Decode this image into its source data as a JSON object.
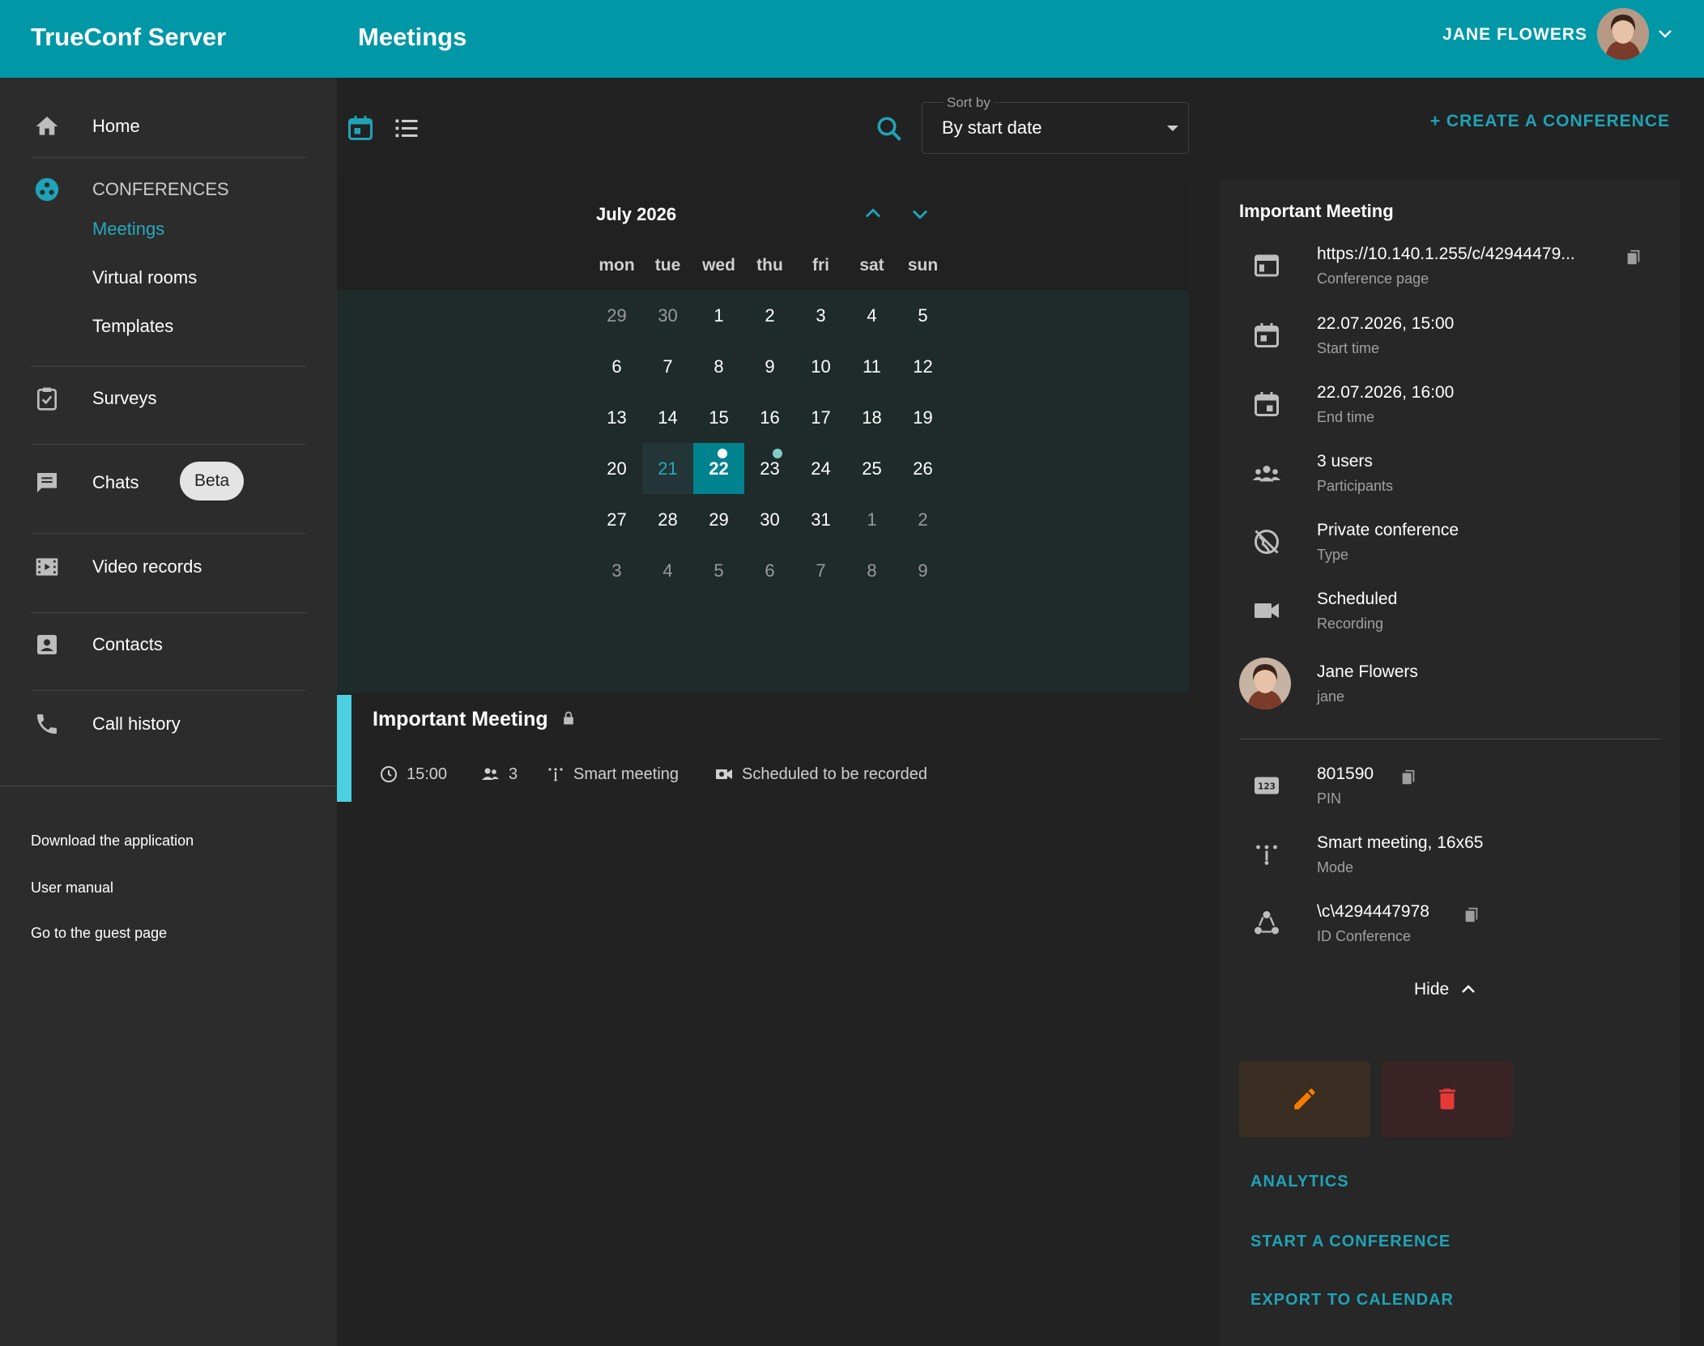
{
  "header": {
    "app_title": "TrueConf Server",
    "page_title": "Meetings",
    "user_name": "JANE FLOWERS"
  },
  "sidebar": {
    "home": "Home",
    "conferences": "CONFERENCES",
    "meetings": "Meetings",
    "virtual_rooms": "Virtual rooms",
    "templates": "Templates",
    "surveys": "Surveys",
    "chats": "Chats",
    "beta": "Beta",
    "video_records": "Video records",
    "contacts": "Contacts",
    "call_history": "Call history",
    "download_app": "Download the application",
    "user_manual": "User manual",
    "guest_page": "Go to the guest page"
  },
  "toolbar": {
    "sort_label": "Sort by",
    "sort_value": "By start date",
    "create_button": "+ CREATE A CONFERENCE"
  },
  "calendar": {
    "month": "July 2026",
    "weekdays": [
      "mon",
      "tue",
      "wed",
      "thu",
      "fri",
      "sat",
      "sun"
    ],
    "weeks": [
      [
        "29",
        "30",
        "1",
        "2",
        "3",
        "4",
        "5"
      ],
      [
        "6",
        "7",
        "8",
        "9",
        "10",
        "11",
        "12"
      ],
      [
        "13",
        "14",
        "15",
        "16",
        "17",
        "18",
        "19"
      ],
      [
        "20",
        "21",
        "22",
        "23",
        "24",
        "25",
        "26"
      ],
      [
        "27",
        "28",
        "29",
        "30",
        "31",
        "1",
        "2"
      ],
      [
        "3",
        "4",
        "5",
        "6",
        "7",
        "8",
        "9"
      ]
    ],
    "today": "21",
    "selected": "22"
  },
  "event": {
    "title": "Important Meeting",
    "time": "15:00",
    "participants": "3",
    "mode": "Smart meeting",
    "recording": "Scheduled to be recorded"
  },
  "details": {
    "title": "Important Meeting",
    "url": "https://10.140.1.255/c/42944479...",
    "url_label": "Conference page",
    "start": "22.07.2026, 15:00",
    "start_label": "Start time",
    "end": "22.07.2026, 16:00",
    "end_label": "End time",
    "users": "3 users",
    "users_label": "Participants",
    "type": "Private conference",
    "type_label": "Type",
    "recording": "Scheduled",
    "recording_label": "Recording",
    "owner_name": "Jane Flowers",
    "owner_login": "jane",
    "pin": "801590",
    "pin_label": "PIN",
    "mode": "Smart meeting, 16x65",
    "mode_label": "Mode",
    "conf_id": "\\c\\4294447978",
    "conf_id_label": "ID Conference",
    "hide": "Hide",
    "analytics": "ANALYTICS",
    "start_conf": "START A CONFERENCE",
    "export": "EXPORT TO CALENDAR"
  },
  "colors": {
    "accent": "#0097a7",
    "link": "#1fa3b6",
    "edit": "#f57c00",
    "delete": "#e53935"
  }
}
